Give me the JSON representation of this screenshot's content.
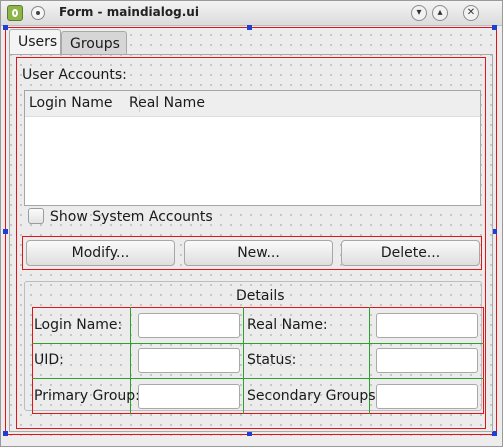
{
  "window": {
    "title": "Form - maindialog.ui"
  },
  "tabs": [
    {
      "label": "Users",
      "active": true
    },
    {
      "label": "Groups",
      "active": false
    }
  ],
  "users_tab": {
    "accounts_label": "User Accounts:",
    "columns": [
      "Login Name",
      "Real Name"
    ],
    "rows": [],
    "show_system_label": "Show System Accounts",
    "show_system_checked": false,
    "buttons": {
      "modify": "Modify...",
      "new": "New...",
      "delete": "Delete..."
    }
  },
  "details": {
    "title": "Details",
    "fields": {
      "login_name": {
        "label": "Login Name:",
        "value": ""
      },
      "real_name": {
        "label": "Real Name:",
        "value": ""
      },
      "uid": {
        "label": "UID:",
        "value": ""
      },
      "status": {
        "label": "Status:",
        "value": ""
      },
      "primary_group": {
        "label": "Primary Group:",
        "value": ""
      },
      "secondary_groups": {
        "label": "Secondary Groups:",
        "value": ""
      }
    }
  },
  "colors": {
    "layout_box": "#e0141a",
    "grid_layout": "#2fa02f",
    "selection_handle": "#1d3fd6"
  },
  "icons": {
    "app": "designer-app-icon",
    "pin": "pin-icon",
    "minimize": "chevron-down-icon",
    "maximize": "chevron-up-icon",
    "close": "close-icon"
  }
}
